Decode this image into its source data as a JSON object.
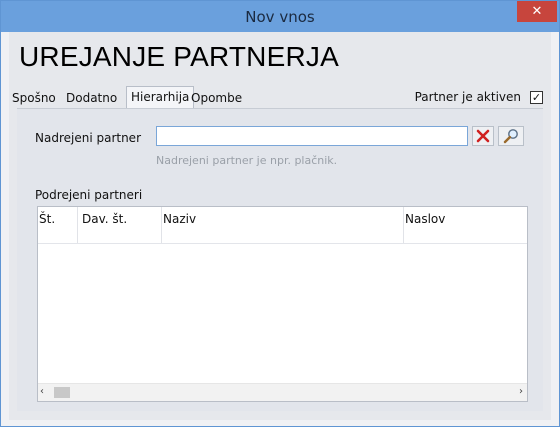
{
  "window": {
    "title": "Nov vnos",
    "close_glyph": "✕"
  },
  "header": {
    "heading": "UREJANJE PARTNERJA"
  },
  "tabs": [
    {
      "label": "Spošno"
    },
    {
      "label": "Dodatno"
    },
    {
      "label": "Hierarhija",
      "active": true
    },
    {
      "label": "Opombe"
    }
  ],
  "active": {
    "label": "Partner je aktiven",
    "checked": true
  },
  "form": {
    "parent_label": "Nadrejeni partner",
    "parent_value": "",
    "hint": "Nadrejeni partner je npr. plačnik."
  },
  "children": {
    "label": "Podrejeni partneri",
    "columns": [
      "Št.",
      "Dav. št.",
      "Naziv",
      "Naslov"
    ]
  },
  "icons": {
    "clear": "close-x-icon",
    "search": "magnifier-icon"
  },
  "colors": {
    "titlebar": "#6aa0dd",
    "close": "#c7453d",
    "clear_red": "#d02020"
  }
}
